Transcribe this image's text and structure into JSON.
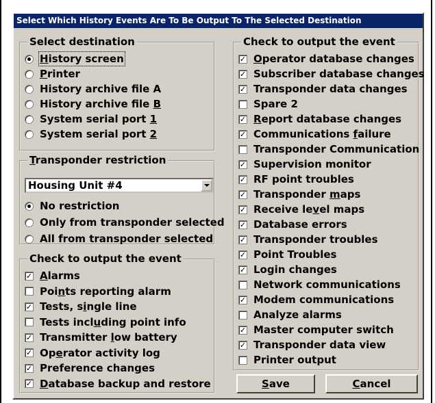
{
  "title": "Select Which History Events Are To Be Output To The Selected Destination",
  "destination": {
    "legend": "Select destination",
    "options": [
      {
        "pre": "",
        "key": "H",
        "post": "istory screen",
        "selected": true
      },
      {
        "pre": "",
        "key": "P",
        "post": "rinter",
        "selected": false
      },
      {
        "pre": "History archive file A",
        "key": "",
        "post": "",
        "selected": false
      },
      {
        "pre": "History archive file ",
        "key": "B",
        "post": "",
        "selected": false
      },
      {
        "pre": "System serial port ",
        "key": "1",
        "post": "",
        "selected": false
      },
      {
        "pre": "System serial port ",
        "key": "2",
        "post": "",
        "selected": false
      }
    ]
  },
  "restriction": {
    "legend_key": "T",
    "legend_rest": "ransponder restriction",
    "combo_value": "Housing Unit #4",
    "options": [
      {
        "label": "No restriction",
        "selected": true
      },
      {
        "label": "Only from transponder selected",
        "selected": false
      },
      {
        "label": "All from transponder selected",
        "selected": false
      }
    ]
  },
  "events_left": {
    "legend": "Check to output the event",
    "items": [
      {
        "pre": "",
        "key": "A",
        "post": "larms",
        "checked": true
      },
      {
        "pre": "Poi",
        "key": "n",
        "post": "ts reporting alarm",
        "checked": false
      },
      {
        "pre": "Tests, s",
        "key": "i",
        "post": "ngle line",
        "checked": true
      },
      {
        "pre": "Tests incl",
        "key": "u",
        "post": "ding point info",
        "checked": false
      },
      {
        "pre": "Transmitter ",
        "key": "l",
        "post": "ow battery",
        "checked": true
      },
      {
        "pre": "Op",
        "key": "e",
        "post": "rator activity log",
        "checked": true
      },
      {
        "pre": "Preference chan",
        "key": "g",
        "post": "es",
        "checked": true
      },
      {
        "pre": "",
        "key": "D",
        "post": "atabase backup and restore",
        "checked": true
      }
    ]
  },
  "events_right": {
    "legend": "Check to output the event",
    "items": [
      {
        "pre": "",
        "key": "O",
        "post": "perator database changes",
        "checked": true
      },
      {
        "pre": "Subscriber database changes",
        "key": "",
        "post": "",
        "checked": true
      },
      {
        "pre": "Transponder data changes",
        "key": "",
        "post": "",
        "checked": true
      },
      {
        "pre": "Spare 2",
        "key": "",
        "post": "",
        "checked": false
      },
      {
        "pre": "",
        "key": "R",
        "post": "eport database changes",
        "checked": true
      },
      {
        "pre": "Communications ",
        "key": "f",
        "post": "ailure",
        "checked": true
      },
      {
        "pre": "Transponder Communication",
        "key": "",
        "post": "",
        "checked": false
      },
      {
        "pre": "Supervision monitor",
        "key": "",
        "post": "",
        "checked": true
      },
      {
        "pre": "RF point troubles",
        "key": "",
        "post": "",
        "checked": true
      },
      {
        "pre": "Transponder ",
        "key": "m",
        "post": "aps",
        "checked": true
      },
      {
        "pre": "Receive le",
        "key": "v",
        "post": "el maps",
        "checked": true
      },
      {
        "pre": "Database errors",
        "key": "",
        "post": "",
        "checked": true
      },
      {
        "pre": "Transponder troubles",
        "key": "",
        "post": "",
        "checked": true
      },
      {
        "pre": "Point Troubles",
        "key": "",
        "post": "",
        "checked": true
      },
      {
        "pre": "Login changes",
        "key": "",
        "post": "",
        "checked": true
      },
      {
        "pre": "Network communications",
        "key": "",
        "post": "",
        "checked": false
      },
      {
        "pre": "Modem communications",
        "key": "",
        "post": "",
        "checked": true
      },
      {
        "pre": "Analyze alarms",
        "key": "",
        "post": "",
        "checked": false
      },
      {
        "pre": "Master computer switch",
        "key": "",
        "post": "",
        "checked": true
      },
      {
        "pre": "Transponder data view",
        "key": "",
        "post": "",
        "checked": true
      },
      {
        "pre": "Printer output",
        "key": "",
        "post": "",
        "checked": false
      }
    ]
  },
  "buttons": {
    "save_key": "S",
    "save_rest": "ave",
    "cancel_key": "C",
    "cancel_rest": "ancel"
  },
  "check_glyph": "✓"
}
